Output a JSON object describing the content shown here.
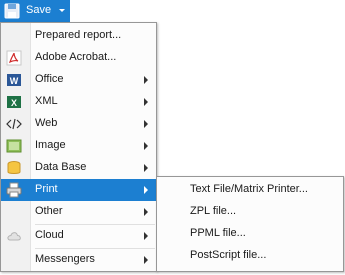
{
  "button": {
    "label": "Save",
    "icon": "floppy-disk-icon",
    "color": "#1c7fd1"
  },
  "menu": {
    "items": [
      {
        "label": "Prepared report...",
        "icon": "none",
        "has_submenu": false
      },
      {
        "label": "Adobe Acrobat...",
        "icon": "pdf-icon",
        "has_submenu": false
      },
      {
        "label": "Office",
        "icon": "word-icon",
        "has_submenu": true
      },
      {
        "label": "XML",
        "icon": "excel-xml-icon",
        "has_submenu": true
      },
      {
        "label": "Web",
        "icon": "code-tag-icon",
        "has_submenu": true
      },
      {
        "label": "Image",
        "icon": "picture-icon",
        "has_submenu": true
      },
      {
        "label": "Data Base",
        "icon": "database-icon",
        "has_submenu": true
      },
      {
        "label": "Print",
        "icon": "printer-icon",
        "has_submenu": true,
        "active": true
      },
      {
        "label": "Other",
        "icon": "none",
        "has_submenu": true
      },
      {
        "label": "Cloud",
        "icon": "cloud-icon",
        "has_submenu": true
      },
      {
        "label": "Messengers",
        "icon": "none",
        "has_submenu": true
      }
    ]
  },
  "submenu": {
    "items": [
      {
        "label": "Text File/Matrix Printer..."
      },
      {
        "label": "ZPL file..."
      },
      {
        "label": "PPML file..."
      },
      {
        "label": "PostScript file..."
      }
    ]
  }
}
